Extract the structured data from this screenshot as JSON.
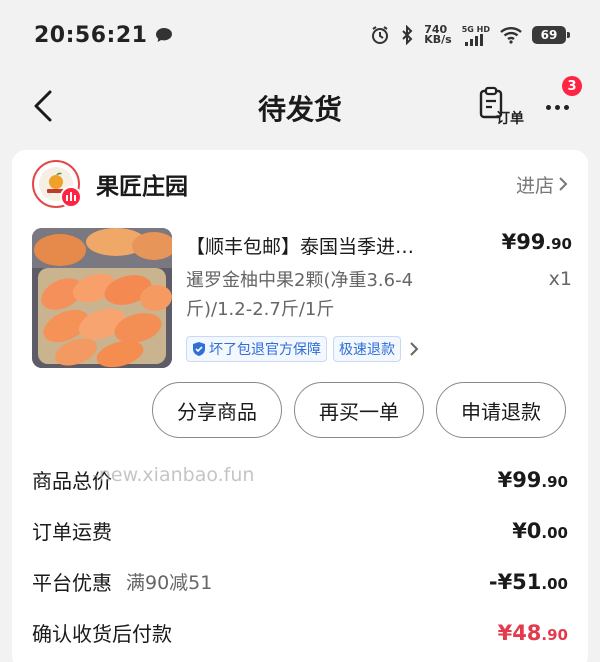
{
  "status_bar": {
    "time": "20:56:21",
    "speed_value": "740",
    "speed_unit": "KB/s",
    "network_label": "5G HD",
    "battery": "69"
  },
  "nav": {
    "title": "待发货",
    "order_label": "订单",
    "more_badge": "3"
  },
  "shop": {
    "name": "果匠庄园",
    "enter_label": "进店"
  },
  "product": {
    "title": "【顺丰包邮】泰国当季进…",
    "price_main": "¥99",
    "price_decimal": ".90",
    "spec": "暹罗金柚中果2颗(净重3.6-4斤)/1.2-2.7斤/1斤",
    "quantity": "x1",
    "tags": [
      "坏了包退官方保障",
      "极速退款"
    ]
  },
  "actions": {
    "share": "分享商品",
    "rebuy": "再买一单",
    "refund": "申请退款"
  },
  "summary": {
    "total_label": "商品总价",
    "total_main": "¥99",
    "total_decimal": ".90",
    "shipping_label": "订单运费",
    "shipping_main": "¥0",
    "shipping_decimal": ".00",
    "discount_label": "平台优惠",
    "discount_desc": "满90减51",
    "discount_main": "-¥51",
    "discount_decimal": ".00",
    "pay_label": "确认收货后付款",
    "pay_main": "¥48",
    "pay_decimal": ".90",
    "watermark": "-new.xianbao.fun"
  },
  "colors": {
    "accent_red": "#ff2442",
    "pay_red": "#e33b4e",
    "tag_blue": "#2f6fd6"
  }
}
